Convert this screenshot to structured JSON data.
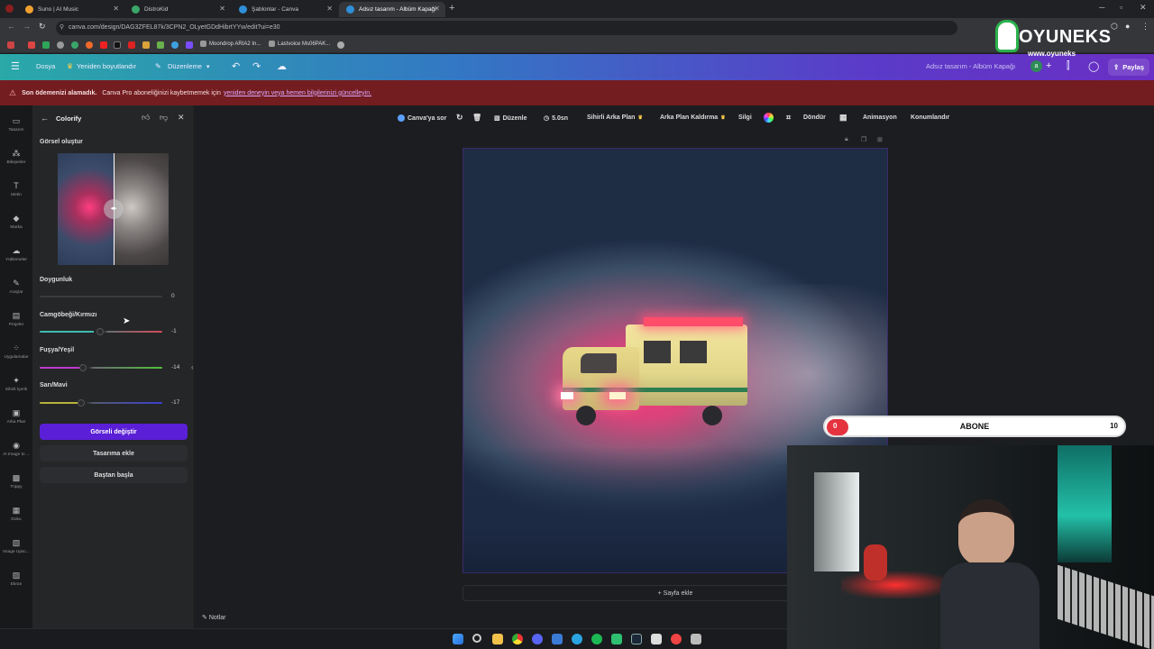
{
  "browser": {
    "tabs": [
      {
        "title": "Suno | AI Music",
        "color": "#f0a030"
      },
      {
        "title": "DistroKid",
        "color": "#3aa66a"
      },
      {
        "title": "Şablonlar - Canva",
        "color": "#2f8fd8"
      },
      {
        "title": "Adsız tasarım - Albüm Kapağı",
        "color": "#2f8fd8"
      }
    ],
    "url": "canva.com/design/DAG3ZFEL87k/3CPN2_OLyetGDdHibrtYYw/edit?ui=e30",
    "bookmarks": [
      "Moondrop ARIA2 In...",
      "Lastvoice Ms06PAK..."
    ]
  },
  "canva_header": {
    "file": "Dosya",
    "resize": "Yeniden boyutlandır",
    "edit_mode": "Düzenleme",
    "design_title": "Adsız tasarım - Albüm Kapağı",
    "avatar_letter": "a",
    "share": "Paylaş"
  },
  "warning": {
    "bold": "Son ödemenizi alamadık.",
    "text": "Canva Pro aboneliğinizi kaybetmemek için",
    "link": "yeniden deneyin veya hemen bilgilerinizi güncelleyin."
  },
  "rail": [
    {
      "label": "Tasarım",
      "icon": "layout-icon"
    },
    {
      "label": "Bileşenler",
      "icon": "elements-icon"
    },
    {
      "label": "Metin",
      "icon": "text-icon"
    },
    {
      "label": "Marka",
      "icon": "brand-icon"
    },
    {
      "label": "Yüklemeler",
      "icon": "upload-icon"
    },
    {
      "label": "Araçlar",
      "icon": "tools-icon"
    },
    {
      "label": "Projeler",
      "icon": "folder-icon"
    },
    {
      "label": "Uygulamalar",
      "icon": "apps-icon"
    },
    {
      "label": "Sihirli İçerik",
      "icon": "magic-icon"
    },
    {
      "label": "Arka Plan",
      "icon": "background-icon"
    },
    {
      "label": "AI Image to ...",
      "icon": "ai-image-icon"
    },
    {
      "label": "Trippy",
      "icon": "trippy-icon"
    },
    {
      "label": "Doku",
      "icon": "texture-icon"
    },
    {
      "label": "Image Upsc...",
      "icon": "upscale-icon"
    },
    {
      "label": "Ekran",
      "icon": "screen-icon"
    }
  ],
  "panel": {
    "title": "Colorify",
    "section": "Görsel oluştur",
    "sliders": [
      {
        "label": "Doygunluk",
        "value": "0",
        "fraction": 0.5
      },
      {
        "label": "Camgöbeği/Kırmızı",
        "value": "-1",
        "fraction": 0.49
      },
      {
        "label": "Fuşya/Yeşil",
        "value": "-14",
        "fraction": 0.36
      },
      {
        "label": "Sarı/Mavi",
        "value": "-17",
        "fraction": 0.34
      }
    ],
    "primary_button": "Görseli değiştir",
    "add_button": "Tasarıma ekle",
    "restart_button": "Baştan başla"
  },
  "toolbar": {
    "ask_canva": "Canva'ya sor",
    "edit": "Düzenle",
    "duration": "5.0sn",
    "magic_bg": "Sihirli Arka Plan",
    "bg_remove": "Arka Plan Kaldırma",
    "erase": "Silgi",
    "rotate": "Döndür",
    "animate": "Animasyon",
    "position": "Konumlandır"
  },
  "canvas": {
    "add_page": "+ Sayfa ekle",
    "notes": "Notlar"
  },
  "overlay": {
    "subscribe_label": "ABONE",
    "current": "0",
    "goal": "10",
    "progress": 0.0,
    "logo_brand": "OYUNEKS",
    "logo_site": "www.oyuneks"
  },
  "colors": {
    "accent_purple": "#5a1fd6",
    "warning_bg": "#741d20",
    "abone_red": "#e5323f"
  }
}
